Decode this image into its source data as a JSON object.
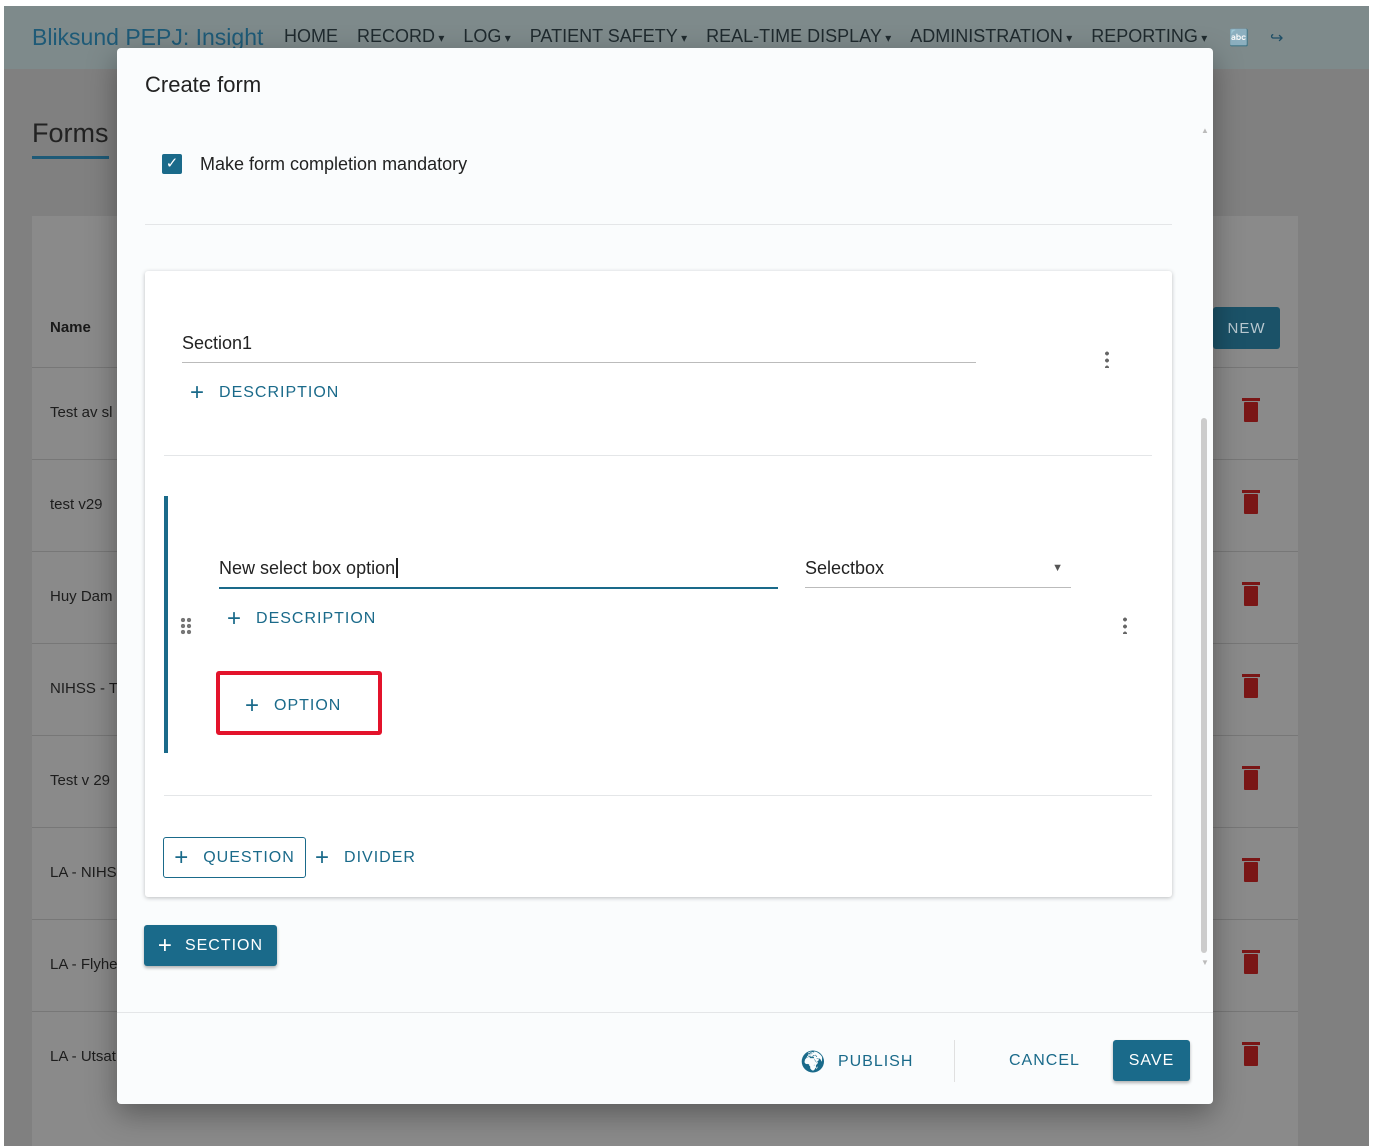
{
  "app": {
    "brand": "Bliksund PEPJ: Insight",
    "nav": [
      {
        "label": "HOME",
        "dropdown": false
      },
      {
        "label": "RECORD",
        "dropdown": true
      },
      {
        "label": "LOG",
        "dropdown": true
      },
      {
        "label": "PATIENT SAFETY",
        "dropdown": true
      },
      {
        "label": "REAL-TIME DISPLAY",
        "dropdown": true
      },
      {
        "label": "ADMINISTRATION",
        "dropdown": true
      },
      {
        "label": "REPORTING",
        "dropdown": true
      }
    ],
    "icons": [
      "language-icon",
      "logout-icon"
    ]
  },
  "background": {
    "title": "Forms",
    "name_header": "Name",
    "new_label": "NEW",
    "rows": [
      "Test av sl",
      "test v29",
      "Huy Dam",
      "NIHSS - T",
      "Test v 29",
      "LA - NIHS",
      "LA - Flyhe",
      "LA - Utsat"
    ]
  },
  "dialog": {
    "title": "Create form",
    "mandatory_label": "Make form completion mandatory",
    "mandatory_checked": true,
    "section": {
      "name": "Section1",
      "description_label": "DESCRIPTION",
      "question": {
        "text": "New select box option",
        "type": "Selectbox",
        "description_label": "DESCRIPTION",
        "option_label": "OPTION"
      },
      "question_label": "QUESTION",
      "divider_label": "DIVIDER"
    },
    "section_label": "SECTION",
    "publish_label": "PUBLISH",
    "cancel_label": "CANCEL",
    "save_label": "SAVE"
  },
  "colors": {
    "accent": "#1a6a8a",
    "highlight": "#e3132b",
    "delete": "#7a1616"
  }
}
